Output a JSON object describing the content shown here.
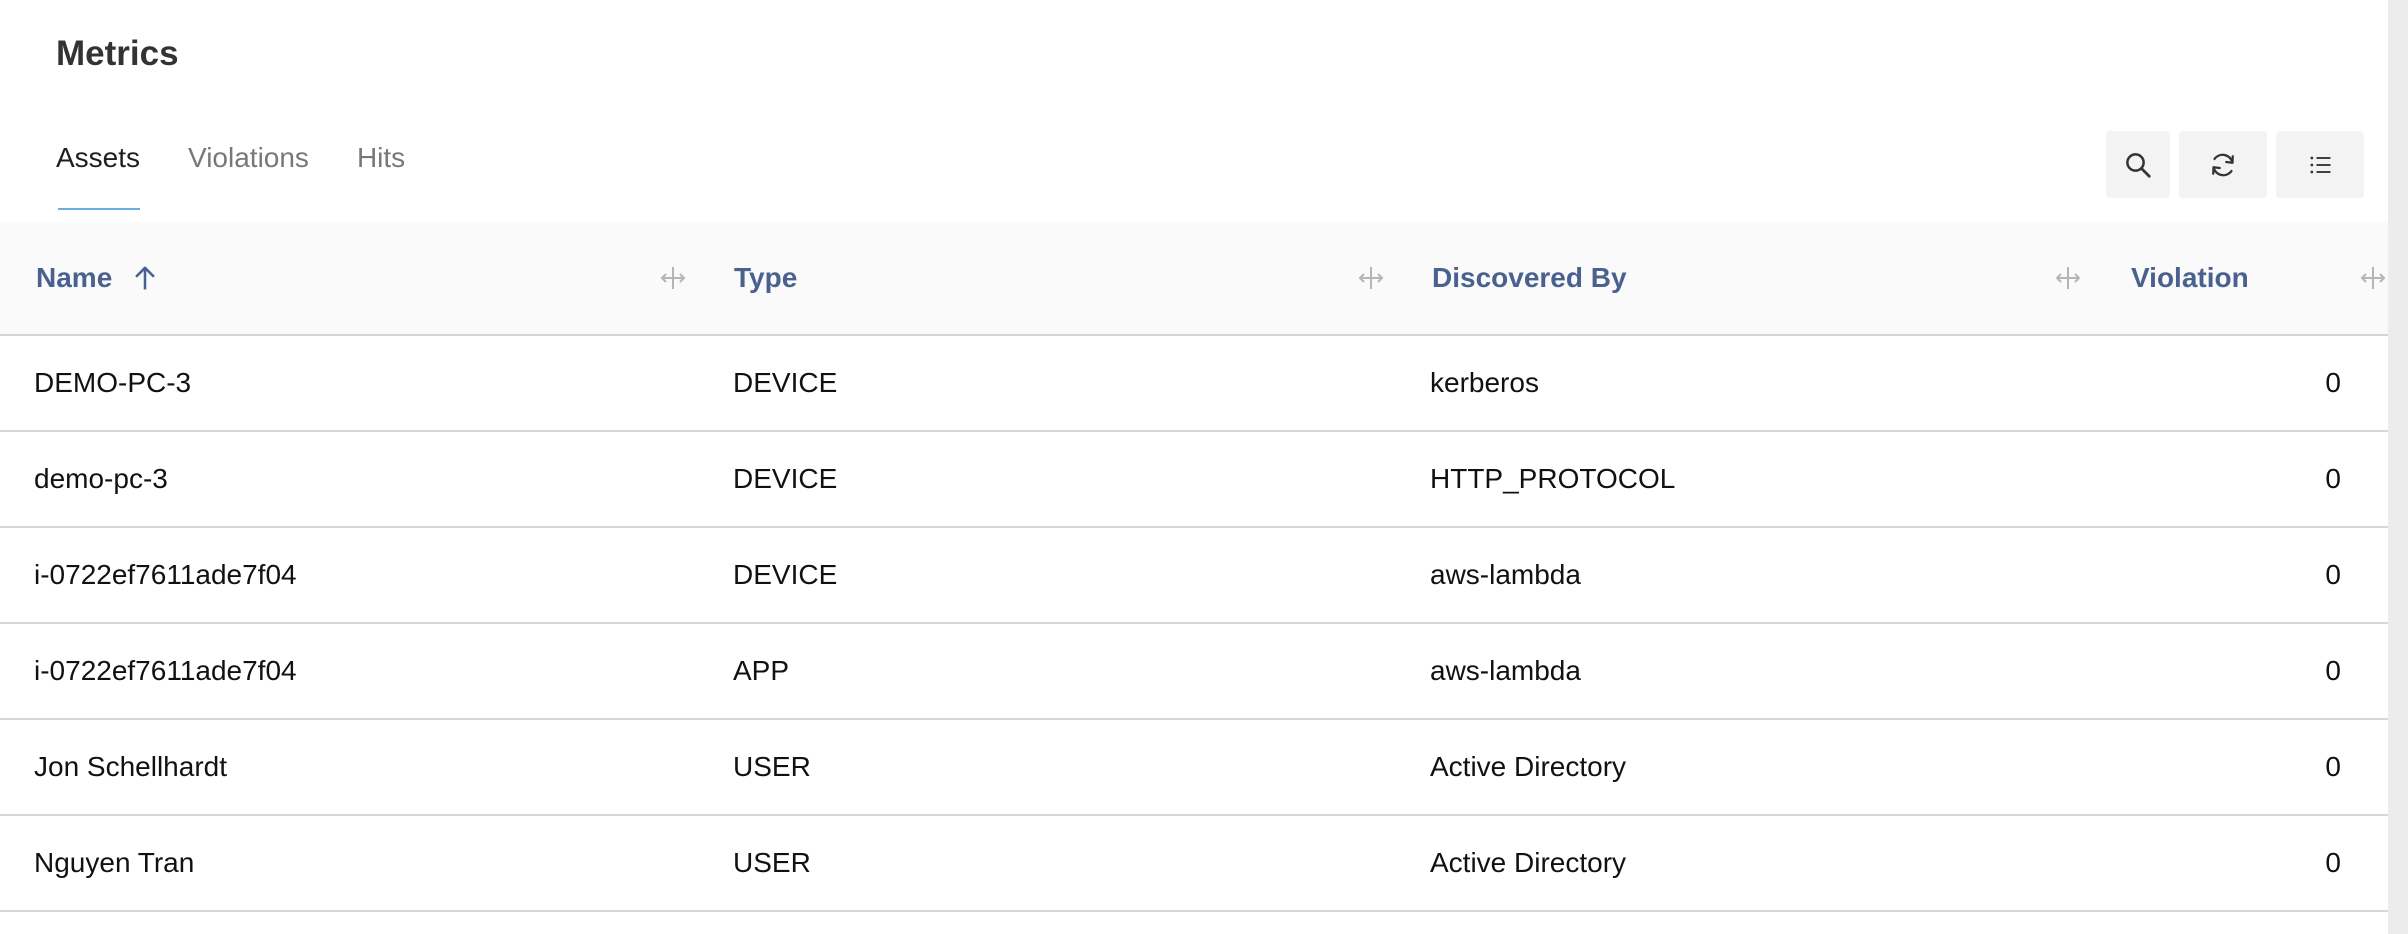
{
  "page": {
    "title": "Metrics"
  },
  "tabs": [
    {
      "label": "Assets",
      "active": true
    },
    {
      "label": "Violations",
      "active": false
    },
    {
      "label": "Hits",
      "active": false
    }
  ],
  "toolbar": {
    "search_icon": "search-icon",
    "refresh_icon": "refresh-icon",
    "list_icon": "list-icon"
  },
  "table": {
    "columns": [
      {
        "label": "Name",
        "sorted": "ascending"
      },
      {
        "label": "Type"
      },
      {
        "label": "Discovered By"
      },
      {
        "label": "Violation"
      }
    ],
    "rows": [
      {
        "name": "DEMO-PC-3",
        "type": "DEVICE",
        "discovered_by": "kerberos",
        "violation": "0"
      },
      {
        "name": "demo-pc-3",
        "type": "DEVICE",
        "discovered_by": "HTTP_PROTOCOL",
        "violation": "0"
      },
      {
        "name": "i-0722ef7611ade7f04",
        "type": "DEVICE",
        "discovered_by": "aws-lambda",
        "violation": "0"
      },
      {
        "name": "i-0722ef7611ade7f04",
        "type": "APP",
        "discovered_by": "aws-lambda",
        "violation": "0"
      },
      {
        "name": "Jon Schellhardt",
        "type": "USER",
        "discovered_by": "Active Directory",
        "violation": "0"
      },
      {
        "name": "Nguyen Tran",
        "type": "USER",
        "discovered_by": "Active Directory",
        "violation": "0"
      }
    ]
  },
  "colors": {
    "header_text": "#4a6190",
    "active_tab_underline": "#6aaee0",
    "header_background": "#fafafa"
  }
}
